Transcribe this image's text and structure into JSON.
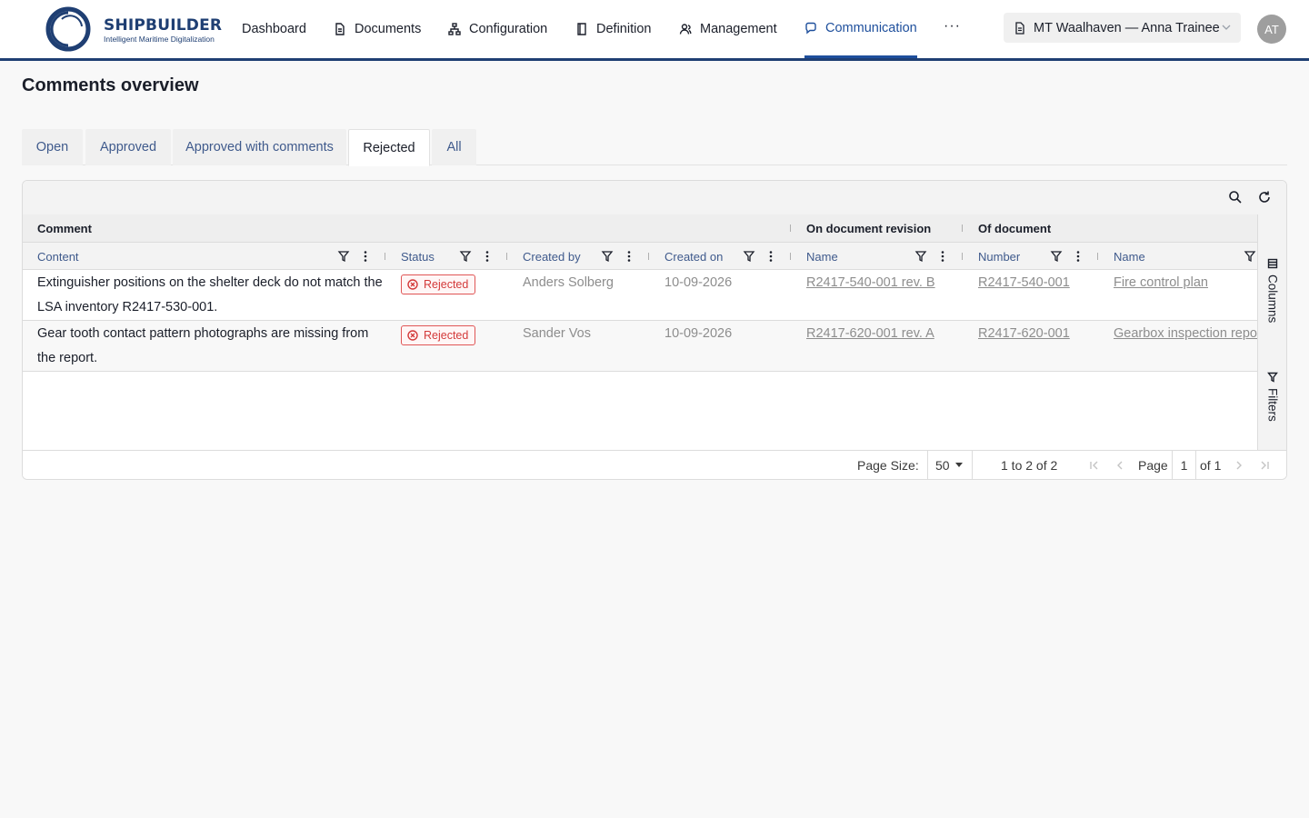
{
  "brand": {
    "name": "SHIPBUILDER",
    "tagline": "Intelligent Maritime Digitalization",
    "color": "#1f3f73"
  },
  "nav": {
    "items": [
      {
        "label": "Dashboard",
        "icon": "none"
      },
      {
        "label": "Documents",
        "icon": "document-icon"
      },
      {
        "label": "Configuration",
        "icon": "hierarchy-icon"
      },
      {
        "label": "Definition",
        "icon": "book-icon"
      },
      {
        "label": "Management",
        "icon": "users-icon"
      },
      {
        "label": "Communication",
        "icon": "chat-icon",
        "active": true
      }
    ],
    "more": "···"
  },
  "context": {
    "ship_user": "MT Waalhaven — Anna Trainee",
    "avatar_initials": "AT"
  },
  "page": {
    "title": "Comments overview"
  },
  "tabs": [
    {
      "label": "Open"
    },
    {
      "label": "Approved"
    },
    {
      "label": "Approved with comments"
    },
    {
      "label": "Rejected",
      "active": true
    },
    {
      "label": "All"
    }
  ],
  "grid": {
    "groups": {
      "comment": "Comment",
      "revision": "On document revision",
      "document": "Of document"
    },
    "columns": {
      "content": "Content",
      "status": "Status",
      "created_by": "Created by",
      "created_on": "Created on",
      "revision_name": "Name",
      "doc_number": "Number",
      "doc_name": "Name"
    },
    "rows": [
      {
        "content": "Extinguisher positions on the shelter deck do not match the LSA inventory R2417-530-001.",
        "status": "Rejected",
        "created_by": "Anders Solberg",
        "created_on": "10-09-2026",
        "revision_name": "R2417-540-001 rev. B",
        "doc_number": "R2417-540-001",
        "doc_name": "Fire control plan"
      },
      {
        "content": "Gear tooth contact pattern photographs are missing from the report.",
        "status": "Rejected",
        "created_by": "Sander Vos",
        "created_on": "10-09-2026",
        "revision_name": "R2417-620-001 rev. A",
        "doc_number": "R2417-620-001",
        "doc_name": "Gearbox inspection report"
      }
    ],
    "side_panel": {
      "columns": "Columns",
      "filters": "Filters"
    },
    "pager": {
      "page_size_label": "Page Size:",
      "page_size": "50",
      "range": "1 to 2 of 2",
      "page_label": "Page",
      "page_current": "1",
      "page_total": "of 1"
    }
  },
  "colors": {
    "accent": "#1e4f9c",
    "rejected": "#d33a3a",
    "header_link": "#3f5a8c"
  }
}
